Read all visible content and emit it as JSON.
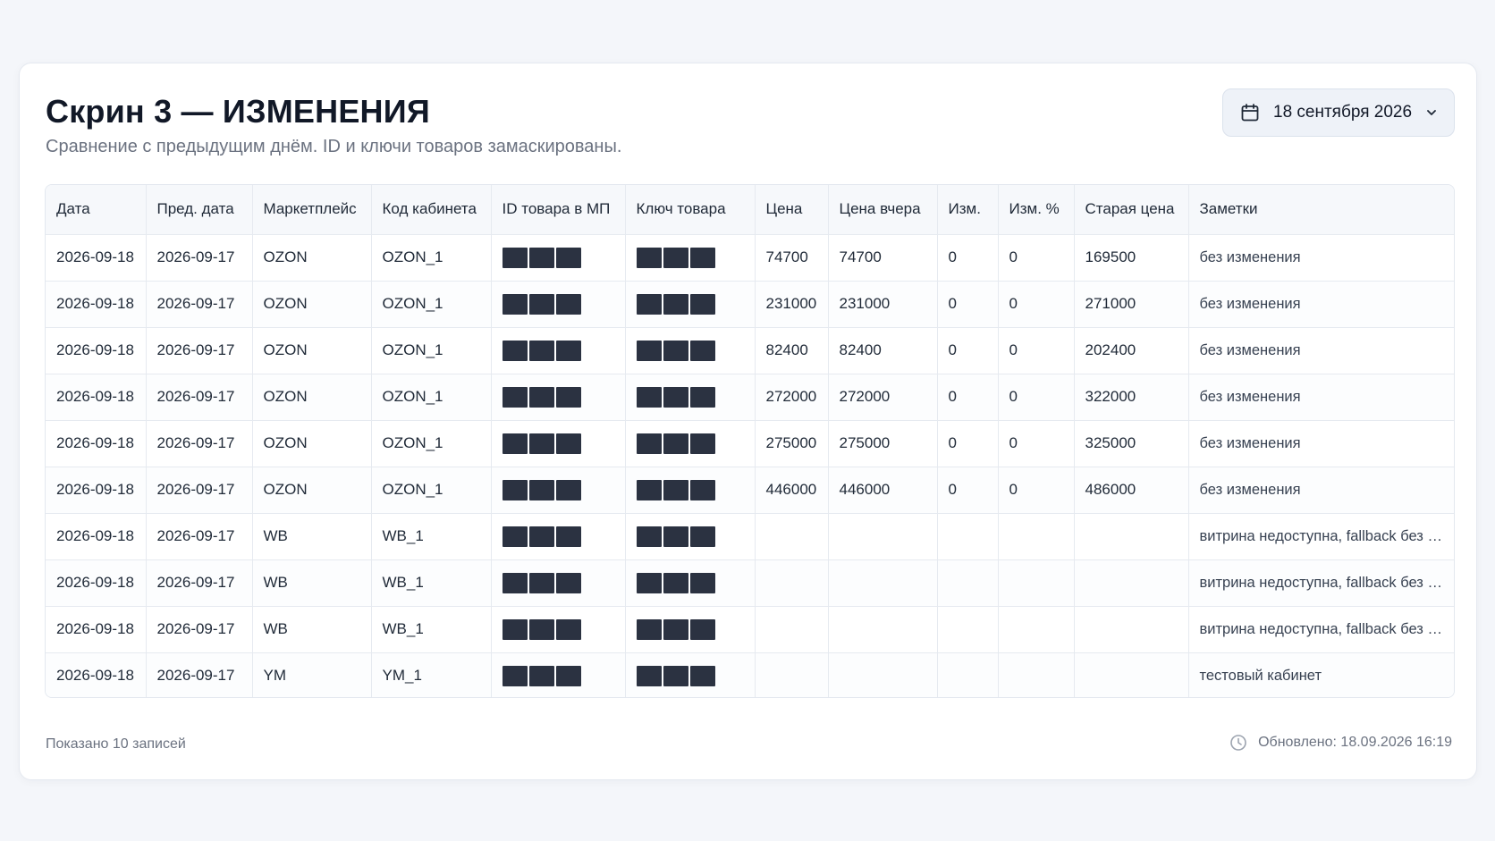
{
  "header": {
    "title": "Скрин 3 — ИЗМЕНЕНИЯ",
    "subtitle": "Сравнение с предыдущим днём. ID и ключи товаров замаскированы.",
    "date_picker": {
      "label": "18 сентября 2026",
      "icon": "calendar-icon",
      "chevron": "chevron-down-icon"
    }
  },
  "table": {
    "columns": [
      "Дата",
      "Пред. дата",
      "Маркетплейс",
      "Код кабинета",
      "ID товара в МП",
      "Ключ товара",
      "Цена",
      "Цена вчера",
      "Изм.",
      "Изм. %",
      "Старая цена",
      "Заметки"
    ],
    "rows": [
      {
        "date": "2026-09-18",
        "prev_date": "2026-09-17",
        "marketplace": "OZON",
        "cabinet": "OZON_1",
        "price": "74700",
        "price_yesterday": "74700",
        "change": "0",
        "change_pct": "0",
        "old_price": "169500",
        "note": "без изменения"
      },
      {
        "date": "2026-09-18",
        "prev_date": "2026-09-17",
        "marketplace": "OZON",
        "cabinet": "OZON_1",
        "price": "231000",
        "price_yesterday": "231000",
        "change": "0",
        "change_pct": "0",
        "old_price": "271000",
        "note": "без изменения"
      },
      {
        "date": "2026-09-18",
        "prev_date": "2026-09-17",
        "marketplace": "OZON",
        "cabinet": "OZON_1",
        "price": "82400",
        "price_yesterday": "82400",
        "change": "0",
        "change_pct": "0",
        "old_price": "202400",
        "note": "без изменения"
      },
      {
        "date": "2026-09-18",
        "prev_date": "2026-09-17",
        "marketplace": "OZON",
        "cabinet": "OZON_1",
        "price": "272000",
        "price_yesterday": "272000",
        "change": "0",
        "change_pct": "0",
        "old_price": "322000",
        "note": "без изменения"
      },
      {
        "date": "2026-09-18",
        "prev_date": "2026-09-17",
        "marketplace": "OZON",
        "cabinet": "OZON_1",
        "price": "275000",
        "price_yesterday": "275000",
        "change": "0",
        "change_pct": "0",
        "old_price": "325000",
        "note": "без изменения"
      },
      {
        "date": "2026-09-18",
        "prev_date": "2026-09-17",
        "marketplace": "OZON",
        "cabinet": "OZON_1",
        "price": "446000",
        "price_yesterday": "446000",
        "change": "0",
        "change_pct": "0",
        "old_price": "486000",
        "note": "без изменения"
      },
      {
        "date": "2026-09-18",
        "prev_date": "2026-09-17",
        "marketplace": "WB",
        "cabinet": "WB_1",
        "price": "",
        "price_yesterday": "",
        "change": "",
        "change_pct": "",
        "old_price": "",
        "note": "витрина недоступна, fallback без sp..."
      },
      {
        "date": "2026-09-18",
        "prev_date": "2026-09-17",
        "marketplace": "WB",
        "cabinet": "WB_1",
        "price": "",
        "price_yesterday": "",
        "change": "",
        "change_pct": "",
        "old_price": "",
        "note": "витрина недоступна, fallback без sp..."
      },
      {
        "date": "2026-09-18",
        "prev_date": "2026-09-17",
        "marketplace": "WB",
        "cabinet": "WB_1",
        "price": "",
        "price_yesterday": "",
        "change": "",
        "change_pct": "",
        "old_price": "",
        "note": "витрина недоступна, fallback без sp..."
      },
      {
        "date": "2026-09-18",
        "prev_date": "2026-09-17",
        "marketplace": "YM",
        "cabinet": "YM_1",
        "price": "",
        "price_yesterday": "",
        "change": "",
        "change_pct": "",
        "old_price": "",
        "note": "тестовый кабинет"
      }
    ]
  },
  "footer": {
    "records": "Показано 10 записей",
    "updated": "Обновлено: 18.09.2026 16:19",
    "updated_icon": "clock-icon"
  }
}
